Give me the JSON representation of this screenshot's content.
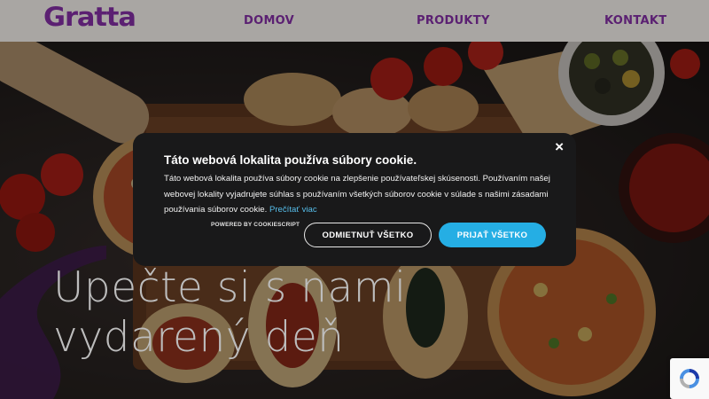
{
  "header": {
    "logo": "Gratta",
    "nav": {
      "home": "DOMOV",
      "products": "PRODUKTY",
      "contact": "KONTAKT"
    }
  },
  "hero": {
    "title_line1": "Upečte si s nami",
    "title_line2": "vydarený deň"
  },
  "cookie": {
    "close": "×",
    "title": "Táto webová lokalita používa súbory cookie.",
    "body": "Táto webová lokalita používa súbory cookie na zlepšenie používateľskej skúsenosti. Používaním našej webovej lokality vyjadrujete súhlas s používaním všetkých súborov cookie v súlade s našimi zásadami používania súborov cookie.",
    "read_more": "Prečítať viac",
    "powered_by": "POWERED BY COOKIESCRIPT",
    "reject_label": "ODMIETNUŤ VŠETKO",
    "accept_label": "PRIJAŤ VŠETKO"
  },
  "colors": {
    "brand_purple": "#5b2072",
    "header_bg": "#a9a6a3",
    "dialog_bg": "#19191a",
    "accept_blue": "#25aee4",
    "link_blue": "#56bde9"
  },
  "icons": {
    "close": "close-icon",
    "recaptcha": "recaptcha-icon"
  }
}
